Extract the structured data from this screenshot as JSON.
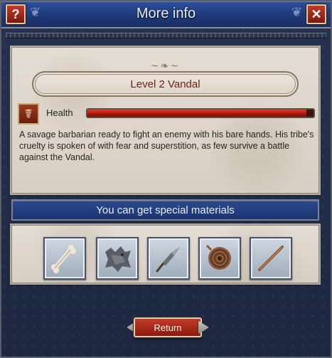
{
  "window": {
    "title": "More info",
    "help_label": "?",
    "close_label": "✕"
  },
  "unit": {
    "name": "Level 2 Vandal",
    "health_label": "Health",
    "health_fraction": 0.97,
    "description": "A savage barbarian ready to fight an enemy with his bare hands. His tribe's cruelty is spoken of with fear and superstition, as few survive a battle against the Vandal."
  },
  "materials": {
    "header": "You can get special materials",
    "items": [
      {
        "icon": "bone-icon"
      },
      {
        "icon": "animal-pelt-icon"
      },
      {
        "icon": "spearhead-icon"
      },
      {
        "icon": "rope-coil-icon"
      },
      {
        "icon": "wooden-shaft-icon"
      }
    ]
  },
  "actions": {
    "return_label": "Return"
  },
  "colors": {
    "title_bar": "#1f3a7a",
    "health_fill": "#b31a12",
    "parchment": "#ddd4c8",
    "button_red": "#a8281a"
  }
}
